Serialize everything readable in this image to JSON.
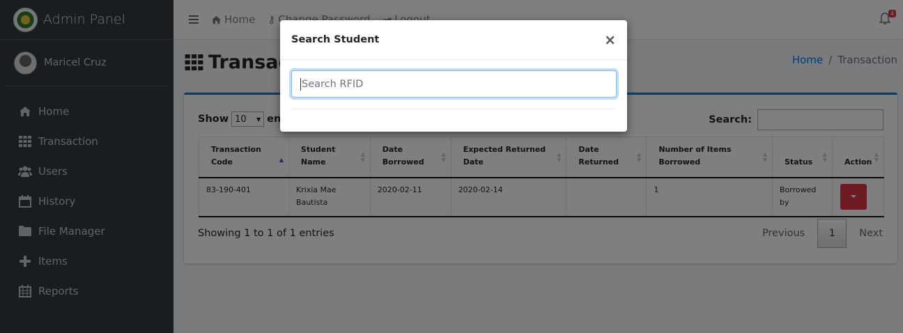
{
  "sidebar": {
    "brand": "Admin Panel",
    "user": "Maricel Cruz",
    "items": [
      {
        "label": "Home",
        "icon": "home-icon"
      },
      {
        "label": "Transaction",
        "icon": "grid-icon"
      },
      {
        "label": "Users",
        "icon": "users-icon"
      },
      {
        "label": "History",
        "icon": "calendar-icon"
      },
      {
        "label": "File Manager",
        "icon": "folder-icon"
      },
      {
        "label": "Items",
        "icon": "plus-icon"
      },
      {
        "label": "Reports",
        "icon": "calendar-grid-icon"
      }
    ]
  },
  "navbar": {
    "home": "Home",
    "change_password": "Change Password",
    "logout": "Logout",
    "notification_count": "4"
  },
  "page": {
    "title": "Transaction",
    "breadcrumb_home": "Home",
    "breadcrumb_current": "Transaction"
  },
  "table": {
    "show_label": "Show",
    "length_value": "10",
    "entries_label": "entries",
    "search_label": "Search:",
    "columns": [
      "Transaction Code",
      "Student Name",
      "Date Borrowed",
      "Expected Returned Date",
      "Date Returned",
      "Number of Items Borrowed",
      "Status",
      "Action"
    ],
    "rows": [
      {
        "code": "83-190-401",
        "student": "Krixia Mae Bautista",
        "borrowed": "2020-02-11",
        "expected": "2020-02-14",
        "returned": "",
        "count": "1",
        "status": "Borrowed by"
      }
    ],
    "info": "Showing 1 to 1 of 1 entries",
    "prev": "Previous",
    "page": "1",
    "next": "Next"
  },
  "modal": {
    "title": "Search Student",
    "close": "×",
    "input_placeholder": "Search RFID"
  },
  "colors": {
    "sidebar": "#343a40",
    "primary": "#007bff",
    "danger": "#dc3545"
  }
}
